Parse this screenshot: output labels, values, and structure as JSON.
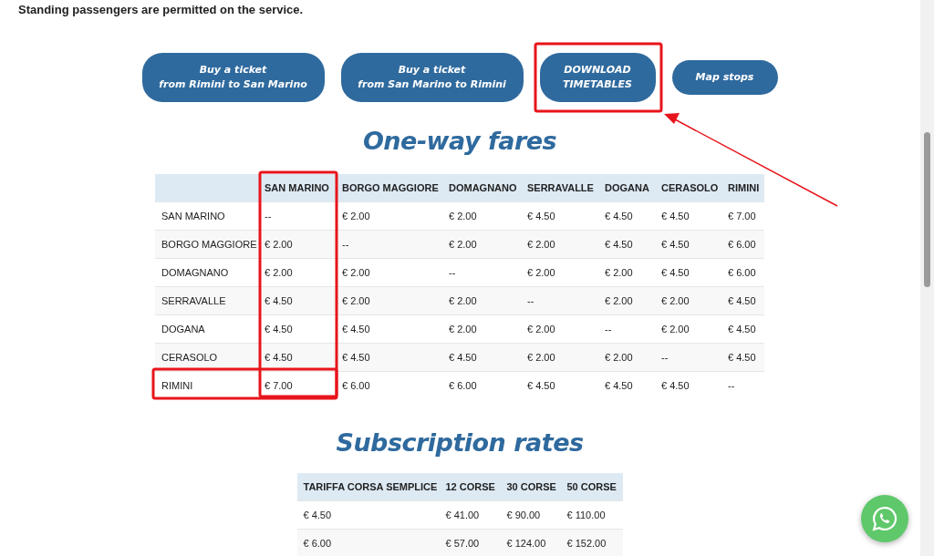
{
  "notice": "Standing passengers are permitted on the service.",
  "buttons": [
    {
      "lines": [
        "Buy a ticket",
        "from Rimini to San Marino"
      ],
      "kind": "wide"
    },
    {
      "lines": [
        "Buy a ticket",
        "from San Marino to Rimini"
      ],
      "kind": "wide"
    },
    {
      "lines": [
        "DOWNLOAD",
        "TIMETABLES"
      ],
      "kind": "medium"
    },
    {
      "lines": [
        "Map stops"
      ],
      "kind": "small"
    }
  ],
  "fares": {
    "title": "One-way fares",
    "columns": [
      "",
      "SAN MARINO",
      "BORGO MAGGIORE",
      "DOMAGNANO",
      "SERRAVALLE",
      "DOGANA",
      "CERASOLO",
      "RIMINI"
    ],
    "rows": [
      [
        "SAN MARINO",
        "--",
        "€ 2.00",
        "€ 2.00",
        "€ 4.50",
        "€ 4.50",
        "€ 4.50",
        "€ 7.00"
      ],
      [
        "BORGO MAGGIORE",
        "€ 2.00",
        "--",
        "€ 2.00",
        "€ 2.00",
        "€ 4.50",
        "€ 4.50",
        "€ 6.00"
      ],
      [
        "DOMAGNANO",
        "€ 2.00",
        "€ 2.00",
        "--",
        "€ 2.00",
        "€ 2.00",
        "€ 4.50",
        "€ 6.00"
      ],
      [
        "SERRAVALLE",
        "€ 4.50",
        "€ 2.00",
        "€ 2.00",
        "--",
        "€ 2.00",
        "€ 2.00",
        "€ 4.50"
      ],
      [
        "DOGANA",
        "€ 4.50",
        "€ 4.50",
        "€ 2.00",
        "€ 2.00",
        "--",
        "€ 2.00",
        "€ 4.50"
      ],
      [
        "CERASOLO",
        "€ 4.50",
        "€ 4.50",
        "€ 4.50",
        "€ 2.00",
        "€ 2.00",
        "--",
        "€ 4.50"
      ],
      [
        "RIMINI",
        "€ 7.00",
        "€ 6.00",
        "€ 6.00",
        "€ 4.50",
        "€ 4.50",
        "€ 4.50",
        "--"
      ]
    ]
  },
  "subscriptions": {
    "title": "Subscription rates",
    "columns": [
      "TARIFFA CORSA SEMPLICE",
      "12 CORSE",
      "30 CORSE",
      "50 CORSE"
    ],
    "rows": [
      [
        "€ 4.50",
        "€ 41.00",
        "€ 90.00",
        "€ 110.00"
      ],
      [
        "€ 6.00",
        "€ 57.00",
        "€ 124.00",
        "€ 152.00"
      ]
    ]
  }
}
